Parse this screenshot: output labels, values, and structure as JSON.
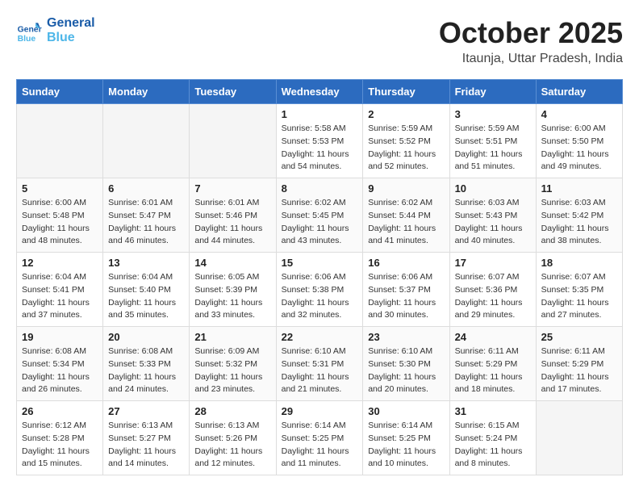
{
  "header": {
    "logo_line1": "General",
    "logo_line2": "Blue",
    "month": "October 2025",
    "location": "Itaunja, Uttar Pradesh, India"
  },
  "weekdays": [
    "Sunday",
    "Monday",
    "Tuesday",
    "Wednesday",
    "Thursday",
    "Friday",
    "Saturday"
  ],
  "weeks": [
    [
      {
        "day": "",
        "detail": ""
      },
      {
        "day": "",
        "detail": ""
      },
      {
        "day": "",
        "detail": ""
      },
      {
        "day": "1",
        "detail": "Sunrise: 5:58 AM\nSunset: 5:53 PM\nDaylight: 11 hours\nand 54 minutes."
      },
      {
        "day": "2",
        "detail": "Sunrise: 5:59 AM\nSunset: 5:52 PM\nDaylight: 11 hours\nand 52 minutes."
      },
      {
        "day": "3",
        "detail": "Sunrise: 5:59 AM\nSunset: 5:51 PM\nDaylight: 11 hours\nand 51 minutes."
      },
      {
        "day": "4",
        "detail": "Sunrise: 6:00 AM\nSunset: 5:50 PM\nDaylight: 11 hours\nand 49 minutes."
      }
    ],
    [
      {
        "day": "5",
        "detail": "Sunrise: 6:00 AM\nSunset: 5:48 PM\nDaylight: 11 hours\nand 48 minutes."
      },
      {
        "day": "6",
        "detail": "Sunrise: 6:01 AM\nSunset: 5:47 PM\nDaylight: 11 hours\nand 46 minutes."
      },
      {
        "day": "7",
        "detail": "Sunrise: 6:01 AM\nSunset: 5:46 PM\nDaylight: 11 hours\nand 44 minutes."
      },
      {
        "day": "8",
        "detail": "Sunrise: 6:02 AM\nSunset: 5:45 PM\nDaylight: 11 hours\nand 43 minutes."
      },
      {
        "day": "9",
        "detail": "Sunrise: 6:02 AM\nSunset: 5:44 PM\nDaylight: 11 hours\nand 41 minutes."
      },
      {
        "day": "10",
        "detail": "Sunrise: 6:03 AM\nSunset: 5:43 PM\nDaylight: 11 hours\nand 40 minutes."
      },
      {
        "day": "11",
        "detail": "Sunrise: 6:03 AM\nSunset: 5:42 PM\nDaylight: 11 hours\nand 38 minutes."
      }
    ],
    [
      {
        "day": "12",
        "detail": "Sunrise: 6:04 AM\nSunset: 5:41 PM\nDaylight: 11 hours\nand 37 minutes."
      },
      {
        "day": "13",
        "detail": "Sunrise: 6:04 AM\nSunset: 5:40 PM\nDaylight: 11 hours\nand 35 minutes."
      },
      {
        "day": "14",
        "detail": "Sunrise: 6:05 AM\nSunset: 5:39 PM\nDaylight: 11 hours\nand 33 minutes."
      },
      {
        "day": "15",
        "detail": "Sunrise: 6:06 AM\nSunset: 5:38 PM\nDaylight: 11 hours\nand 32 minutes."
      },
      {
        "day": "16",
        "detail": "Sunrise: 6:06 AM\nSunset: 5:37 PM\nDaylight: 11 hours\nand 30 minutes."
      },
      {
        "day": "17",
        "detail": "Sunrise: 6:07 AM\nSunset: 5:36 PM\nDaylight: 11 hours\nand 29 minutes."
      },
      {
        "day": "18",
        "detail": "Sunrise: 6:07 AM\nSunset: 5:35 PM\nDaylight: 11 hours\nand 27 minutes."
      }
    ],
    [
      {
        "day": "19",
        "detail": "Sunrise: 6:08 AM\nSunset: 5:34 PM\nDaylight: 11 hours\nand 26 minutes."
      },
      {
        "day": "20",
        "detail": "Sunrise: 6:08 AM\nSunset: 5:33 PM\nDaylight: 11 hours\nand 24 minutes."
      },
      {
        "day": "21",
        "detail": "Sunrise: 6:09 AM\nSunset: 5:32 PM\nDaylight: 11 hours\nand 23 minutes."
      },
      {
        "day": "22",
        "detail": "Sunrise: 6:10 AM\nSunset: 5:31 PM\nDaylight: 11 hours\nand 21 minutes."
      },
      {
        "day": "23",
        "detail": "Sunrise: 6:10 AM\nSunset: 5:30 PM\nDaylight: 11 hours\nand 20 minutes."
      },
      {
        "day": "24",
        "detail": "Sunrise: 6:11 AM\nSunset: 5:29 PM\nDaylight: 11 hours\nand 18 minutes."
      },
      {
        "day": "25",
        "detail": "Sunrise: 6:11 AM\nSunset: 5:29 PM\nDaylight: 11 hours\nand 17 minutes."
      }
    ],
    [
      {
        "day": "26",
        "detail": "Sunrise: 6:12 AM\nSunset: 5:28 PM\nDaylight: 11 hours\nand 15 minutes."
      },
      {
        "day": "27",
        "detail": "Sunrise: 6:13 AM\nSunset: 5:27 PM\nDaylight: 11 hours\nand 14 minutes."
      },
      {
        "day": "28",
        "detail": "Sunrise: 6:13 AM\nSunset: 5:26 PM\nDaylight: 11 hours\nand 12 minutes."
      },
      {
        "day": "29",
        "detail": "Sunrise: 6:14 AM\nSunset: 5:25 PM\nDaylight: 11 hours\nand 11 minutes."
      },
      {
        "day": "30",
        "detail": "Sunrise: 6:14 AM\nSunset: 5:25 PM\nDaylight: 11 hours\nand 10 minutes."
      },
      {
        "day": "31",
        "detail": "Sunrise: 6:15 AM\nSunset: 5:24 PM\nDaylight: 11 hours\nand 8 minutes."
      },
      {
        "day": "",
        "detail": ""
      }
    ]
  ]
}
